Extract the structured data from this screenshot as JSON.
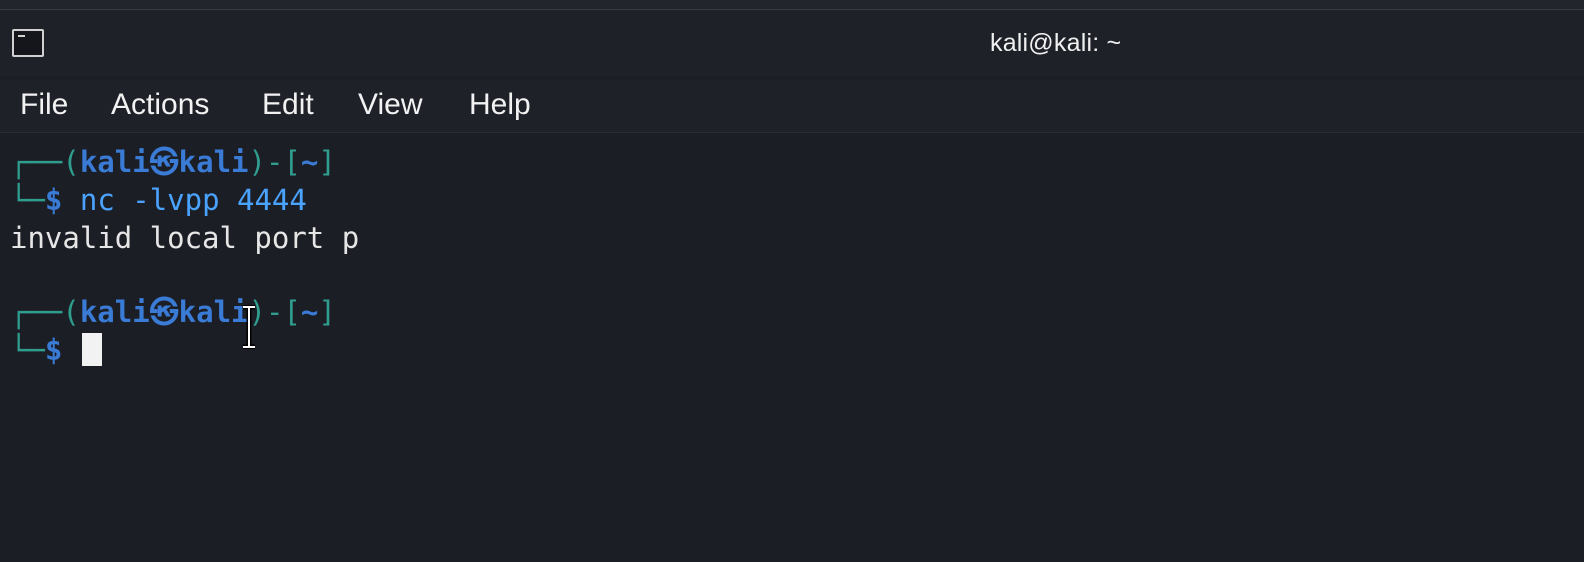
{
  "window": {
    "title": "kali@kali: ~"
  },
  "menubar": {
    "items": [
      "File",
      "Actions",
      "Edit",
      "View",
      "Help"
    ]
  },
  "terminal": {
    "prompt1": {
      "open": "┌──(",
      "user": "kali㉿kali",
      "mid": ")-[",
      "dir": "~",
      "close": "]"
    },
    "command1": {
      "bracket": "└─",
      "dollar": "$",
      "cmd": "nc",
      "args": "-lvpp 4444"
    },
    "output1": "invalid local port p",
    "prompt2": {
      "open": "┌──(",
      "user": "kali㉿kali",
      "mid": ")-[",
      "dir": "~",
      "close": "]"
    },
    "command2": {
      "bracket": "└─",
      "dollar": "$"
    }
  },
  "colors": {
    "background": "#1c1e26",
    "prompt_bracket": "#2f9e8f",
    "prompt_user": "#3a7bd5",
    "command": "#4aa3ff"
  }
}
